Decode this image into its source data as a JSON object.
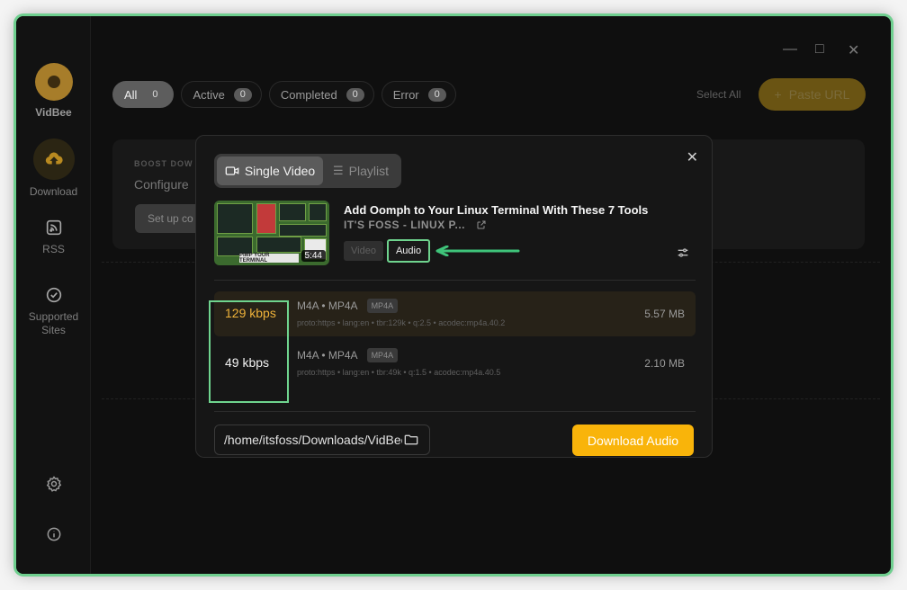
{
  "app": {
    "brand": "VidBee"
  },
  "sidebar": {
    "items": [
      {
        "label": "Download"
      },
      {
        "label": "RSS"
      },
      {
        "label": "Supported Sites"
      }
    ]
  },
  "filters": [
    {
      "label": "All",
      "count": "0",
      "active": true
    },
    {
      "label": "Active",
      "count": "0"
    },
    {
      "label": "Completed",
      "count": "0"
    },
    {
      "label": "Error",
      "count": "0"
    }
  ],
  "toolbar": {
    "select_all": "Select All",
    "paste_url": "Paste URL"
  },
  "boost": {
    "label": "BOOST DOW",
    "title": "Configure",
    "button": "Set up co"
  },
  "modal": {
    "tabs": {
      "single": "Single Video",
      "playlist": "Playlist"
    },
    "video": {
      "title": "Add Oomph to Your Linux Terminal With These 7 Tools",
      "channel": "IT'S FOSS - LINUX P...",
      "duration": "5:44",
      "thumb_caption": "PIMP YOUR TERMINAL"
    },
    "type_tabs": {
      "video": "Video",
      "audio": "Audio"
    },
    "formats": [
      {
        "bitrate": "129 kbps",
        "format": "M4A • MP4A",
        "badge": "MP4A",
        "meta": "proto:https • lang:en • tbr:129k • q:2.5 • acodec:mp4a.40.2",
        "size": "5.57 MB",
        "selected": true
      },
      {
        "bitrate": "49 kbps",
        "format": "M4A • MP4A",
        "badge": "MP4A",
        "meta": "proto:https • lang:en • tbr:49k • q:1.5 • acodec:mp4a.40.5",
        "size": "2.10 MB"
      }
    ],
    "path": "/home/itsfoss/Downloads/VidBee",
    "download_button": "Download Audio"
  },
  "colors": {
    "accent": "#f9b40a",
    "highlight": "#6fd48e"
  }
}
